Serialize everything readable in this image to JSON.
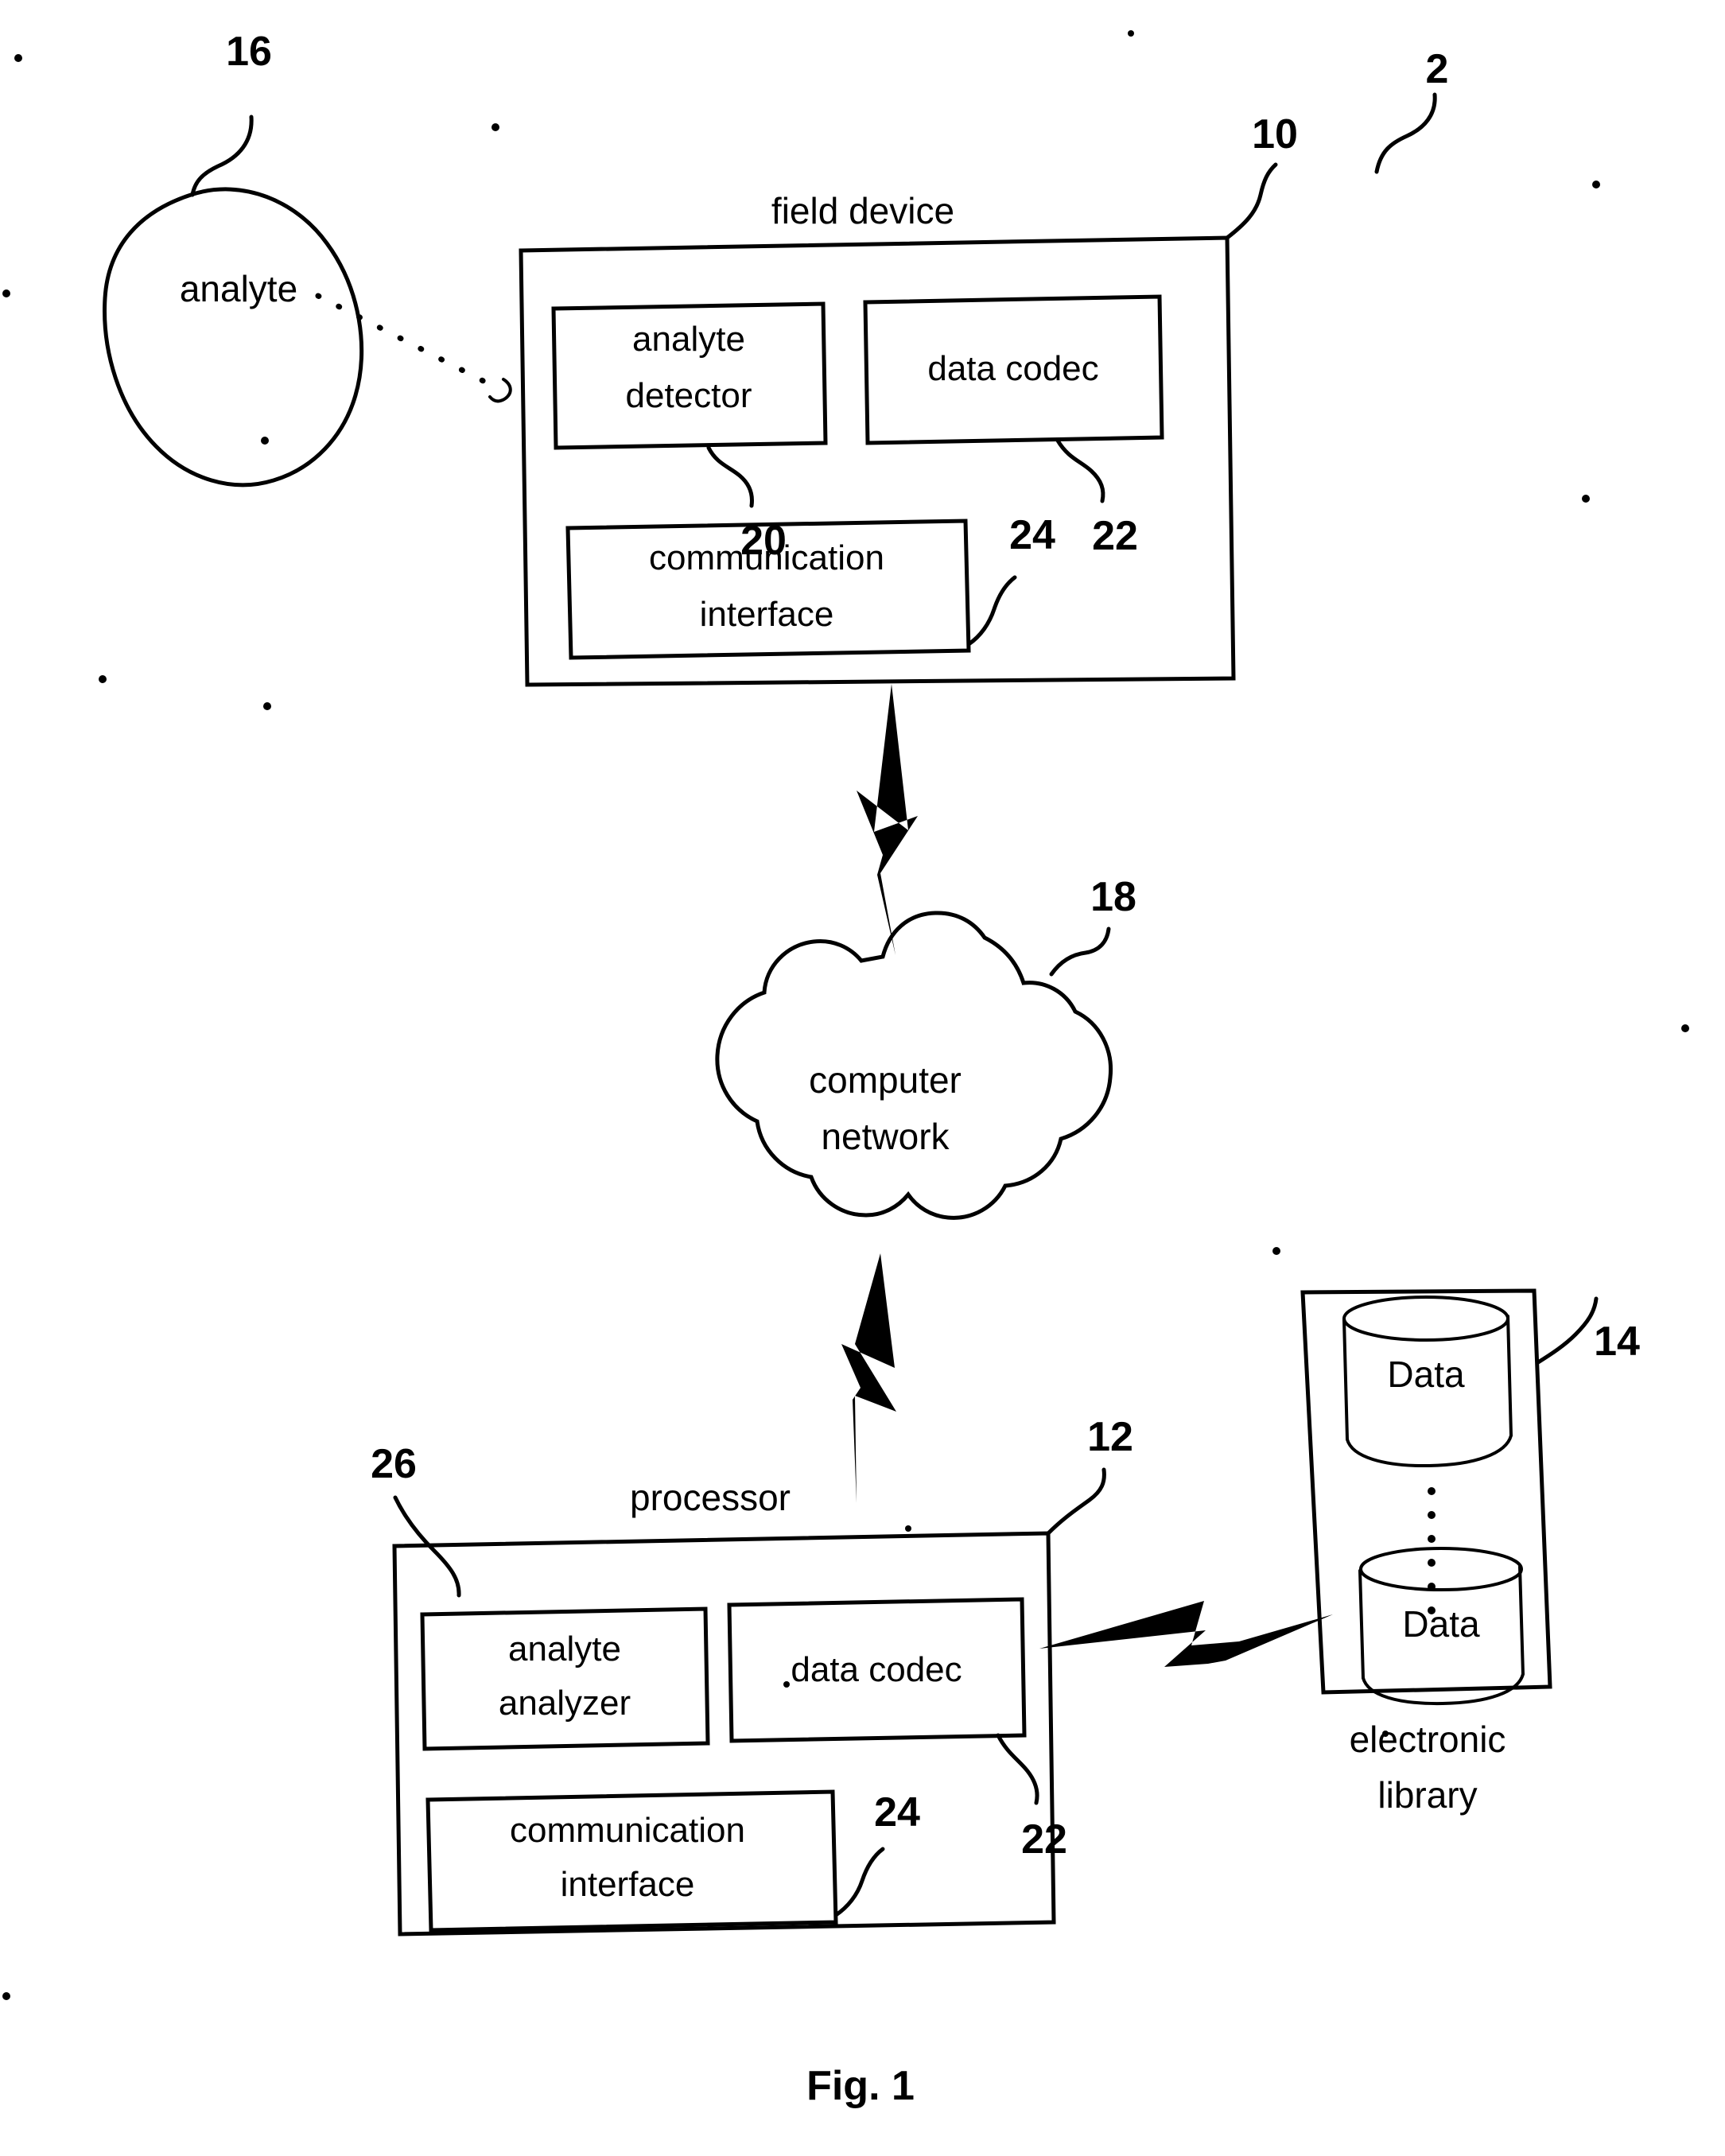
{
  "figure": {
    "caption": "Fig. 1",
    "system_ref": "2"
  },
  "nodes": {
    "analyte": {
      "label": "analyte",
      "ref": "16"
    },
    "field_device": {
      "label": "field device",
      "ref": "10",
      "blocks": [
        {
          "label_line1": "analyte",
          "label_line2": "detector",
          "ref": "20"
        },
        {
          "label_line1": "data codec",
          "label_line2": "",
          "ref": "22"
        },
        {
          "label_line1": "communication",
          "label_line2": "interface",
          "ref": "24"
        }
      ]
    },
    "computer_network": {
      "label_line1": "computer",
      "label_line2": "network",
      "ref": "18"
    },
    "processor": {
      "label": "processor",
      "ref": "12",
      "analyzer_ref": "26",
      "blocks": [
        {
          "label_line1": "analyte",
          "label_line2": "analyzer",
          "ref": "26"
        },
        {
          "label_line1": "data codec",
          "label_line2": "",
          "ref": "22"
        },
        {
          "label_line1": "communication",
          "label_line2": "interface",
          "ref": "24"
        }
      ]
    },
    "electronic_library": {
      "label_line1": "electronic",
      "label_line2": "library",
      "ref": "14",
      "stores": [
        {
          "label": "Data"
        },
        {
          "label": "Data"
        }
      ],
      "ellipsis": "⋮"
    }
  },
  "connections": {
    "analyte_to_field_device": "dotted-arrow",
    "field_device_to_network": "lightning-bolt",
    "network_to_processor": "lightning-bolt",
    "processor_to_library": "lightning-bolt"
  },
  "colors": {
    "ink": "#000000",
    "paper": "#ffffff"
  }
}
